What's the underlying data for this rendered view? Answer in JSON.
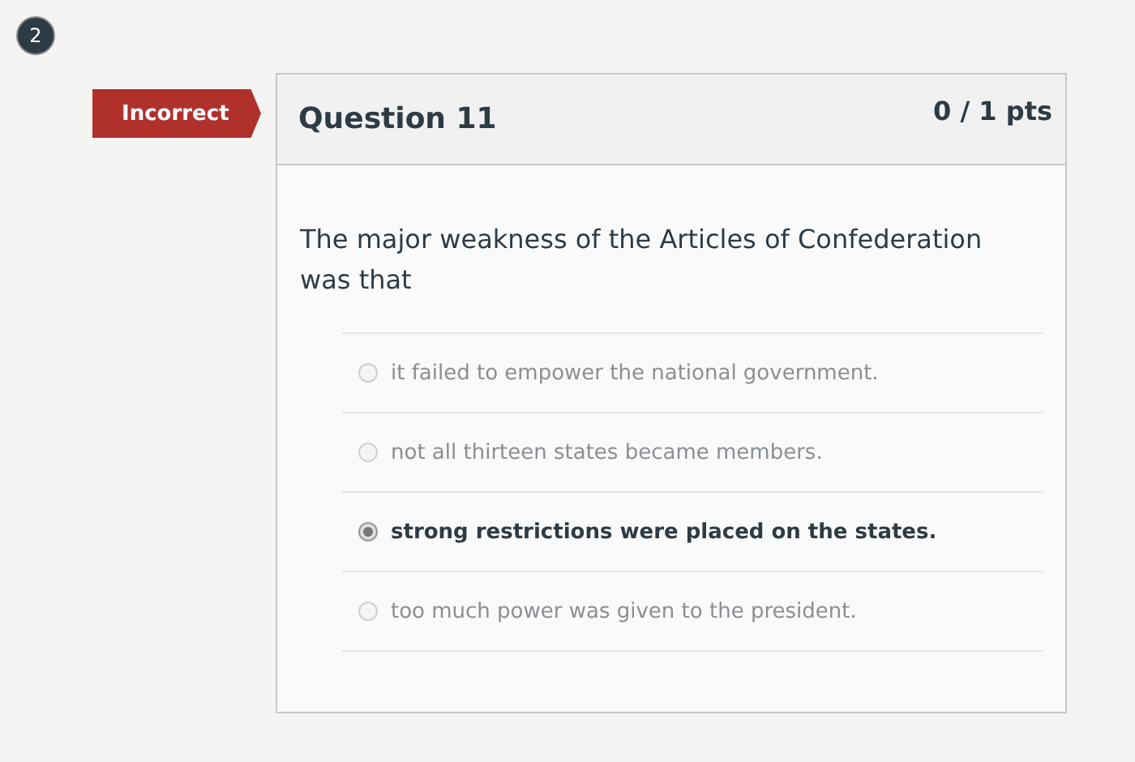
{
  "step_badge": "2",
  "result_tag": "Incorrect",
  "question": {
    "title": "Question 11",
    "points": "0 / 1 pts",
    "text": "The major weakness of the Articles of Confederation was that"
  },
  "answers": [
    {
      "label": "it failed to empower the national government.",
      "selected": false
    },
    {
      "label": "not all thirteen states became members.",
      "selected": false
    },
    {
      "label": "strong restrictions were placed on the states.",
      "selected": true
    },
    {
      "label": "too much power was given to the president.",
      "selected": false
    }
  ]
}
